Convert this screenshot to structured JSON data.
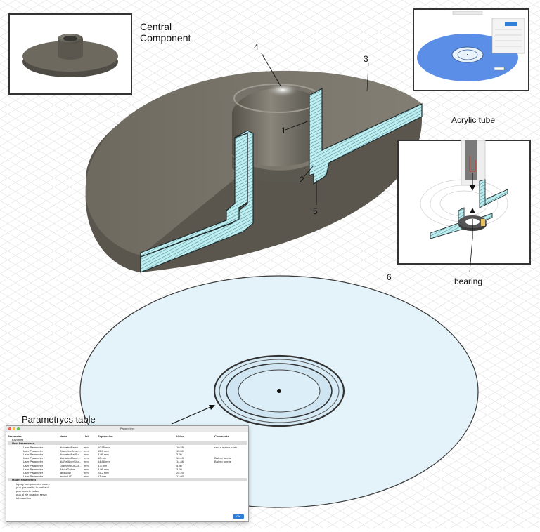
{
  "labels": {
    "central_component": [
      "Central",
      "Component"
    ],
    "num_1": "1",
    "num_2": "2",
    "num_3": "3",
    "num_4": "4",
    "num_5": "5",
    "num_6": "6",
    "acrylic_tube": "Acrylic tube",
    "bearing": "bearing",
    "parametrics_table": "Parametrycs table"
  },
  "colors": {
    "body_gray": "#716d63",
    "body_gray_dark": "#4f4c45",
    "body_gray_light": "#8f8b81",
    "section_cyan": "#bfeef0",
    "disc_fill": "#e4f3fa",
    "disc_blue": "#5b8ee6"
  },
  "parameters_dialog": {
    "window_title": "Parameters",
    "columns": [
      "Parameter",
      "Name",
      "Unit",
      "Expression",
      "Value",
      "Comments"
    ],
    "favorites": "Favorites",
    "user_parameters_group": "User Parameters",
    "rows": [
      [
        "User Parameter",
        "diametroRemo...",
        "mm",
        "10.55 mm",
        "10.55",
        "raio a marco junto"
      ],
      [
        "User Parameter",
        "DiametroCrown...",
        "mm",
        "13.5 mm",
        "13.50",
        ""
      ],
      [
        "User Parameter",
        "diametroBarSu...",
        "mm",
        "3.95 mm",
        "3.95",
        ""
      ],
      [
        "User Parameter",
        "diametroMotor...",
        "mm",
        "10 mm",
        "10.00",
        "Balero fuente"
      ],
      [
        "User Parameter",
        "diaRefAberSitu...",
        "mm",
        "14.86 mm",
        "14.86",
        "Balero fuente"
      ],
      [
        "User Parameter",
        "DiametroCirCul...",
        "mm",
        "5.8 mm",
        "5.80",
        ""
      ],
      [
        "User Parameter",
        "AlturaDalem",
        "mm",
        "3.98 mm",
        "3.98",
        ""
      ],
      [
        "User Parameter",
        "largoUID",
        "mm",
        "25.2 mm",
        "25.20",
        ""
      ],
      [
        "User Parameter",
        "anchoUID",
        "mm",
        "13 mm",
        "13.00",
        ""
      ]
    ],
    "model_parameters_group": "Model Parameters",
    "model_rows": [
      "tapa y componentes mec...",
      "pua que ocritte la ocrilla d...",
      "pua soporte balero",
      "pua al eje rotacion servo",
      "tubo acrilico"
    ],
    "ok_label": "OK"
  }
}
